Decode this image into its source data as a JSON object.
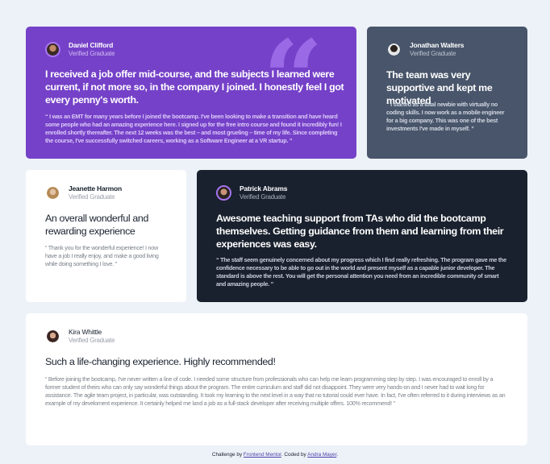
{
  "testimonials": [
    {
      "name": "Daniel Clifford",
      "role": "Verified Graduate",
      "title": "I received a job offer mid-course, and the subjects I learned were current, if not more so, in the company I joined. I honestly feel I got every penny's worth.",
      "body": "“ I was an EMT for many years before I joined the bootcamp. I've been looking to make a transition and have heard some people who had an amazing experience here. I signed up for the free intro course and found it incredibly fun! I enrolled shortly thereafter. The next 12 weeks was the best – and most grueling – time of my life. Since completing the course, I've successfully switched careers, working as a Software Engineer at a VR startup. ”",
      "card_color": "#7541c8"
    },
    {
      "name": "Jonathan Walters",
      "role": "Verified Graduate",
      "title": "The team was very supportive and kept me motivated",
      "body": "“ I started as a total newbie with virtually no coding skills. I now work as a mobile engineer for a big company. This was one of the best investments I've made in myself. ”",
      "card_color": "#48556a"
    },
    {
      "name": "Jeanette Harmon",
      "role": "Verified Graduate",
      "title": "An overall wonderful and rewarding experience",
      "body": "“ Thank you for the wonderful experience! I now have a job I really enjoy, and make a good living while doing something I love. ”",
      "card_color": "#ffffff"
    },
    {
      "name": "Patrick Abrams",
      "role": "Verified Graduate",
      "title": "Awesome teaching support from TAs who did the bootcamp themselves. Getting guidance from them and learning from their experiences was easy.",
      "body": "“ The staff seem genuinely concerned about my progress which I find really refreshing. The program gave me the confidence necessary to be able to go out in the world and present myself as a capable junior developer. The standard is above the rest. You will get the personal attention you need from an incredible community of smart and amazing people. ”",
      "card_color": "#19212e"
    },
    {
      "name": "Kira Whittle",
      "role": "Verified Graduate",
      "title": "Such a life-changing experience. Highly recommended!",
      "body": "“ Before joining the bootcamp, I've never written a line of code. I needed some structure from professionals who can help me learn programming step by step. I was encouraged to enroll by a former student of theirs who can only say wonderful things about the program. The entire curriculum and staff did not disappoint. They were very hands-on and I never had to wait long for assistance. The agile team project, in particular, was outstanding. It took my learning to the next level in a way that no tutorial could ever have. In fact, I've often referred to it during interviews as an example of my develoment experience. It certainly helped me land a job as a full-stack developer after receiving multiple offers. 100% recommend! ”",
      "card_color": "#ffffff"
    }
  ],
  "quote_glyph": "“",
  "attribution": {
    "prefix": "Challenge by ",
    "challenge_link": "Frontend Mentor",
    "middle": ". Coded by ",
    "author_link": "Andra Mayer",
    "suffix": "."
  },
  "colors": {
    "page_bg": "#edf2f8",
    "accent_purple": "#7541c8",
    "avatar_ring": "#a775f1"
  },
  "icons": {
    "quote": "quote-icon",
    "avatars": [
      "avatar-daniel",
      "avatar-jonathan",
      "avatar-jeanette",
      "avatar-patrick",
      "avatar-kira"
    ]
  }
}
